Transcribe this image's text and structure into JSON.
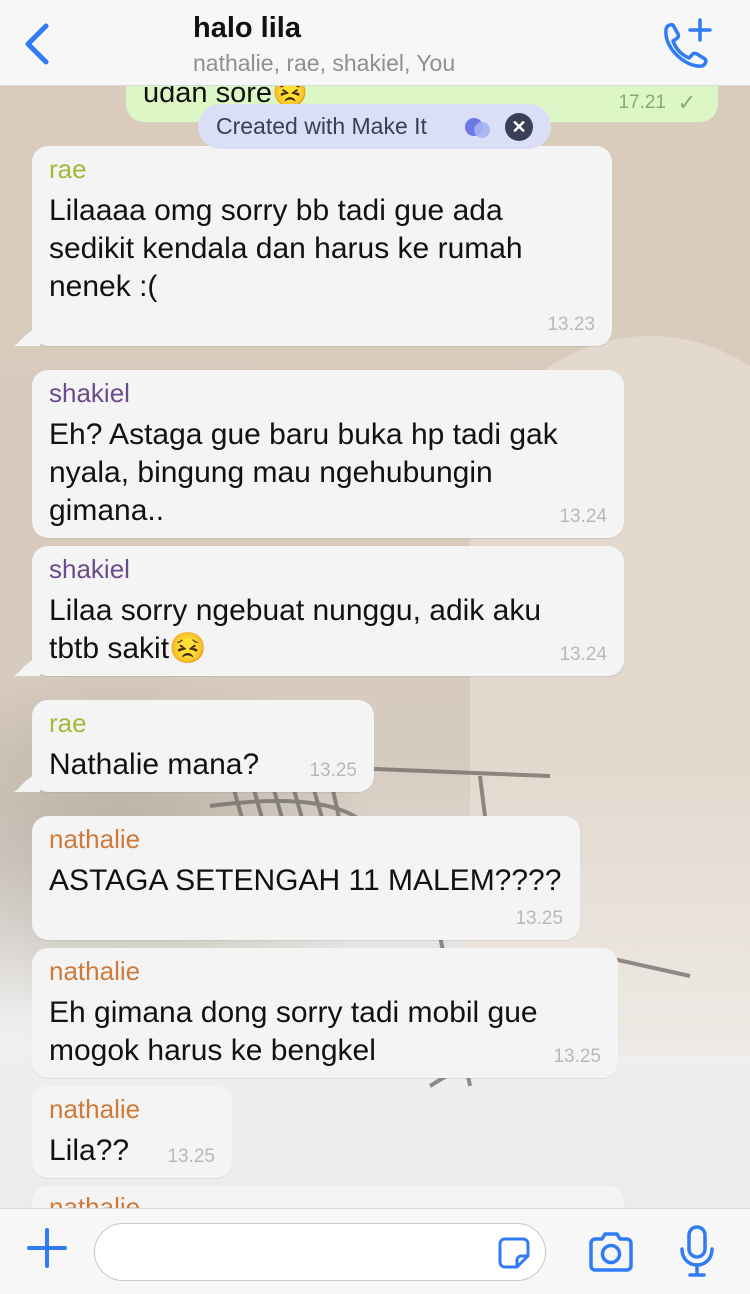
{
  "header": {
    "title": "halo lila",
    "participants": "nathalie, rae, shakiel, You"
  },
  "top_message": {
    "text": "udan sore",
    "time": "17.21"
  },
  "overlay": {
    "label": "Created with Make It"
  },
  "messages": [
    {
      "sender": "rae",
      "lines": [
        "Lilaaaa omg sorry bb tadi gue ada",
        "sedikit kendala dan harus ke rumah",
        "nenek :("
      ],
      "time": "13.23"
    },
    {
      "sender": "shakiel",
      "lines": [
        "Eh? Astaga gue baru buka hp tadi gak",
        "nyala, bingung mau ngehubungin",
        "gimana.."
      ],
      "time": "13.24"
    },
    {
      "sender": "shakiel",
      "lines": [
        "Lilaa sorry ngebuat nunggu, adik aku",
        "tbtb sakit"
      ],
      "time": "13.24"
    },
    {
      "sender": "rae",
      "lines": [
        "Nathalie mana?"
      ],
      "time": "13.25"
    },
    {
      "sender": "nathalie",
      "lines": [
        "ASTAGA SETENGAH 11 MALEM????"
      ],
      "time": "13.25"
    },
    {
      "sender": "nathalie",
      "lines": [
        "Eh gimana dong sorry tadi mobil gue",
        "mogok harus ke bengkel"
      ],
      "time": "13.25"
    },
    {
      "sender": "nathalie",
      "lines": [
        "Lila??"
      ],
      "time": "13.25"
    },
    {
      "sender": "nathalie",
      "lines": [],
      "time": ""
    }
  ],
  "colors": {
    "accent": "#2f7cf6",
    "rae": "#a5b83a",
    "shakiel": "#6a4c8c",
    "nathalie": "#cf7a3a",
    "outgoing_bubble": "#dcf7c5"
  },
  "icons": [
    "back-chevron-icon",
    "add-call-icon",
    "plus-icon",
    "sticker-icon",
    "camera-icon",
    "microphone-icon"
  ]
}
